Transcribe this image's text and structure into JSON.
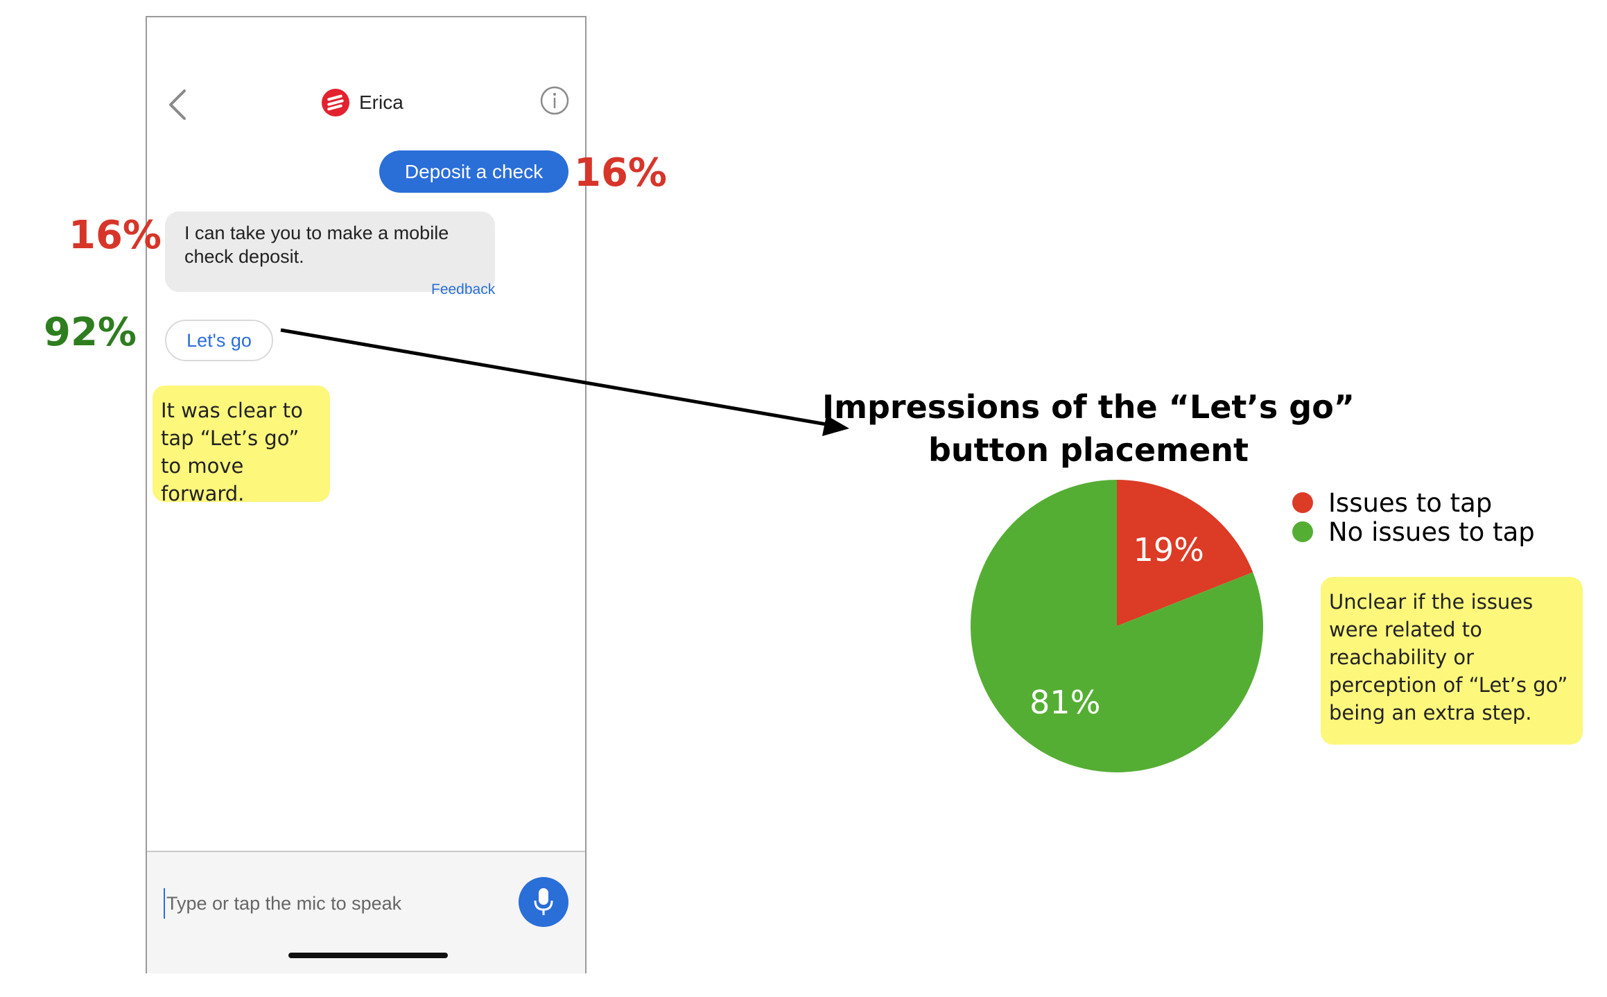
{
  "phone": {
    "header": {
      "title": "Erica"
    },
    "user_message": "Deposit a check",
    "bot_message": "I can take you to make a mobile check deposit.",
    "feedback_label": "Feedback",
    "lets_go_label": "Let's go",
    "input_placeholder": "Type or tap the mic to speak",
    "colors": {
      "brand_red": "#e3212f",
      "accent_blue": "#2a6ed8"
    }
  },
  "annotations": {
    "user_message_pct": "16%",
    "bot_message_pct": "16%",
    "lets_go_pct": "92%",
    "note_left": "It was clear to tap “Let’s go” to move forward.",
    "note_right": "Unclear if the issues were related to reachability or perception of “Let’s go” being an extra step."
  },
  "chart_data": {
    "type": "pie",
    "title": "Impressions of the “Let’s go” button placement",
    "slices": [
      {
        "label": "Issues to tap",
        "value": 19,
        "display": "19%",
        "color": "#dc3b26"
      },
      {
        "label": "No issues to tap",
        "value": 81,
        "display": "81%",
        "color": "#55ae34"
      }
    ],
    "legend_position": "right"
  }
}
